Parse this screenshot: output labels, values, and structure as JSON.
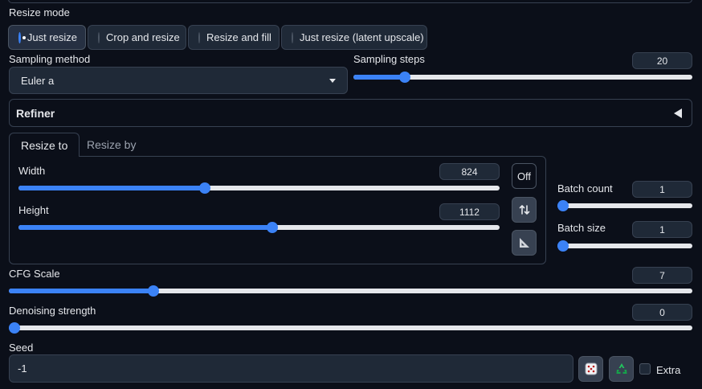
{
  "resize_mode": {
    "label": "Resize mode",
    "options": [
      "Just resize",
      "Crop and resize",
      "Resize and fill",
      "Just resize (latent upscale)"
    ],
    "selected": "Just resize"
  },
  "sampling_method": {
    "label": "Sampling method",
    "value": "Euler a"
  },
  "sampling_steps": {
    "label": "Sampling steps",
    "value": "20",
    "fraction": 0.14
  },
  "refiner": {
    "title": "Refiner"
  },
  "tabs": [
    "Resize to",
    "Resize by"
  ],
  "width": {
    "label": "Width",
    "value": "824",
    "fraction": 0.385
  },
  "height": {
    "label": "Height",
    "value": "1112",
    "fraction": 0.528
  },
  "off_button": "Off",
  "batch_count": {
    "label": "Batch count",
    "value": "1",
    "fraction": 0.0
  },
  "batch_size": {
    "label": "Batch size",
    "value": "1",
    "fraction": 0.0
  },
  "cfg_scale": {
    "label": "CFG Scale",
    "value": "7",
    "fraction": 0.207
  },
  "denoising_strength": {
    "label": "Denoising strength",
    "value": "0",
    "fraction": 0.0
  },
  "seed": {
    "label": "Seed",
    "value": "-1",
    "extra_label": "Extra"
  },
  "colors": {
    "accent": "#3b82f6",
    "background": "#0b0f19",
    "surface": "#1f2937",
    "border": "#374151",
    "recycle": "#22c55e"
  }
}
